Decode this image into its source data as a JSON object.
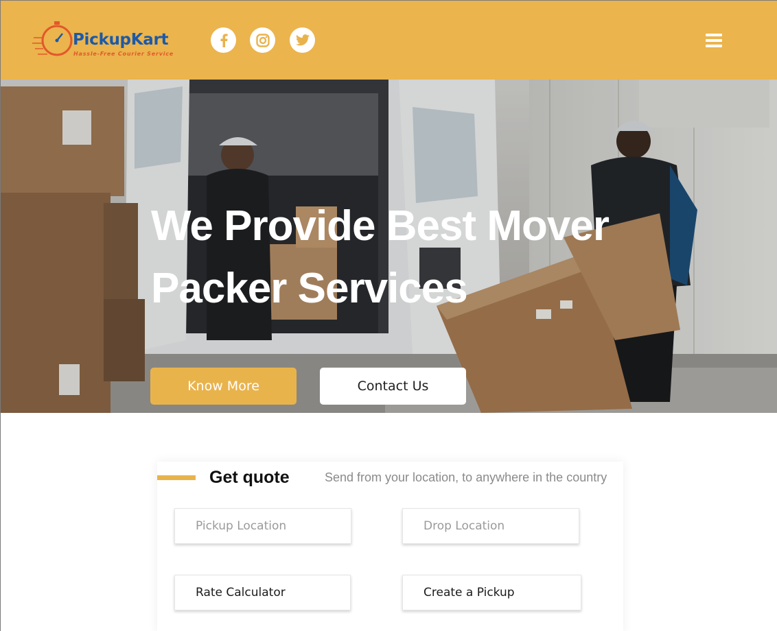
{
  "brand": {
    "name": "PickupKart",
    "tagline": "Hassle-Free Courier Service",
    "primary_color": "#ebb44d",
    "logo_text_color": "#1c5aa8",
    "logo_accent_color": "#e2582a"
  },
  "header": {
    "social": [
      {
        "icon": "facebook-icon"
      },
      {
        "icon": "instagram-icon"
      },
      {
        "icon": "twitter-icon"
      }
    ],
    "menu_icon": "hamburger-menu-icon"
  },
  "hero": {
    "title": "We Provide Best Mover Packer Services",
    "know_more_label": "Know More",
    "contact_label": "Contact Us"
  },
  "quote": {
    "title": "Get quote",
    "subtitle": "Send from your location, to anywhere in the country",
    "pickup_placeholder": "Pickup Location",
    "drop_placeholder": "Drop Location",
    "rate_calculator_label": "Rate Calculator",
    "create_pickup_label": "Create a Pickup"
  }
}
